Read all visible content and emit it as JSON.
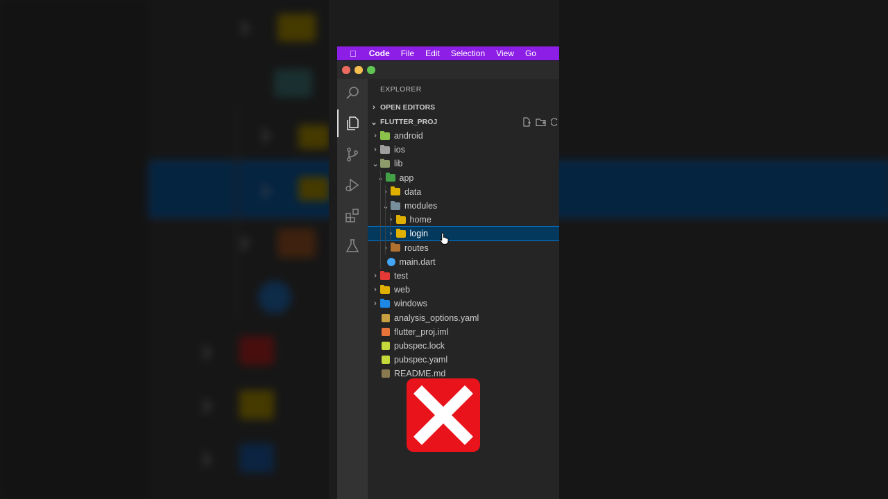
{
  "menubar": {
    "apple_icon": "apple-icon",
    "items": [
      "Code",
      "File",
      "Edit",
      "Selection",
      "View",
      "Go"
    ],
    "color": "#8d1ee6"
  },
  "window": {
    "traffic_lights": [
      "#ed6a5e",
      "#f5bf4f",
      "#61c554"
    ]
  },
  "activity_bar": {
    "icons": [
      "search-icon",
      "files-icon",
      "source-control-icon",
      "run-debug-icon",
      "extensions-icon",
      "testing-icon"
    ],
    "active": "files-icon"
  },
  "sidebar": {
    "title": "EXPLORER",
    "open_editors": "OPEN EDITORS",
    "project": "FLUTTER_PROJ",
    "project_actions": [
      "new-file-icon",
      "new-folder-icon",
      "refresh-icon"
    ],
    "tree": [
      {
        "name": "android",
        "depth": 1,
        "type": "folder",
        "expanded": false,
        "color": "#8bc34a"
      },
      {
        "name": "ios",
        "depth": 1,
        "type": "folder",
        "expanded": false,
        "color": "#9e9e9e"
      },
      {
        "name": "lib",
        "depth": 1,
        "type": "folder",
        "expanded": true,
        "color": "#8d9a6a"
      },
      {
        "name": "app",
        "depth": 2,
        "type": "folder",
        "expanded": true,
        "color": "#43a047"
      },
      {
        "name": "data",
        "depth": 3,
        "type": "folder",
        "expanded": false,
        "color": "#e0b000"
      },
      {
        "name": "modules",
        "depth": 3,
        "type": "folder",
        "expanded": true,
        "color": "#78909c"
      },
      {
        "name": "home",
        "depth": 4,
        "type": "folder",
        "expanded": false,
        "color": "#e0b000"
      },
      {
        "name": "login",
        "depth": 4,
        "type": "folder",
        "expanded": false,
        "color": "#e0b000",
        "selected": true
      },
      {
        "name": "routes",
        "depth": 3,
        "type": "folder",
        "expanded": false,
        "color": "#b07030"
      },
      {
        "name": "main.dart",
        "depth": 2,
        "type": "file",
        "color": "#42a5f5"
      },
      {
        "name": "test",
        "depth": 1,
        "type": "folder",
        "expanded": false,
        "color": "#e53935"
      },
      {
        "name": "web",
        "depth": 1,
        "type": "folder",
        "expanded": false,
        "color": "#e0b000"
      },
      {
        "name": "windows",
        "depth": 1,
        "type": "folder",
        "expanded": false,
        "color": "#1e88e5"
      },
      {
        "name": "analysis_options.yaml",
        "depth": 1,
        "type": "file",
        "color": "#c8a040"
      },
      {
        "name": "flutter_proj.iml",
        "depth": 1,
        "type": "file",
        "color": "#e8743b"
      },
      {
        "name": "pubspec.lock",
        "depth": 1,
        "type": "file",
        "color": "#c5d93a"
      },
      {
        "name": "pubspec.yaml",
        "depth": 1,
        "type": "file",
        "color": "#c5d93a"
      },
      {
        "name": "README.md",
        "depth": 1,
        "type": "file",
        "color": "#8a7a50"
      }
    ]
  },
  "overlay": {
    "icon": "red-x-icon",
    "color": "#e8131b"
  }
}
